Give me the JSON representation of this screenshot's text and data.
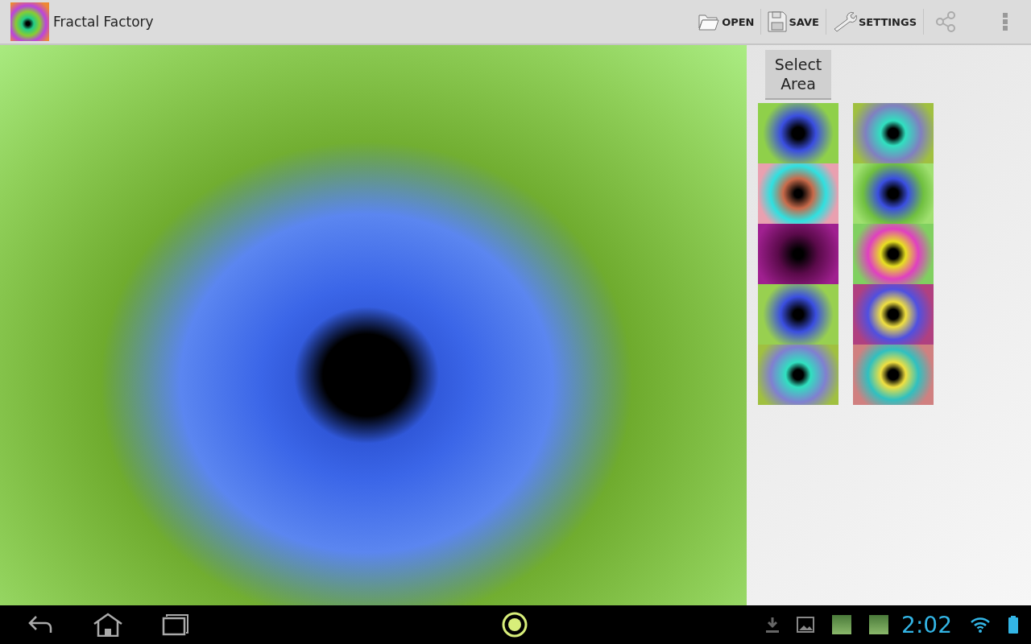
{
  "action_bar": {
    "title": "Fractal Factory",
    "actions": [
      {
        "label": "OPEN",
        "kind": "open"
      },
      {
        "label": "SAVE",
        "kind": "save"
      },
      {
        "label": "SETTINGS",
        "kind": "settings"
      }
    ]
  },
  "side_panel": {
    "button": "Select Area"
  },
  "system_bar": {
    "clock": "2:02"
  }
}
